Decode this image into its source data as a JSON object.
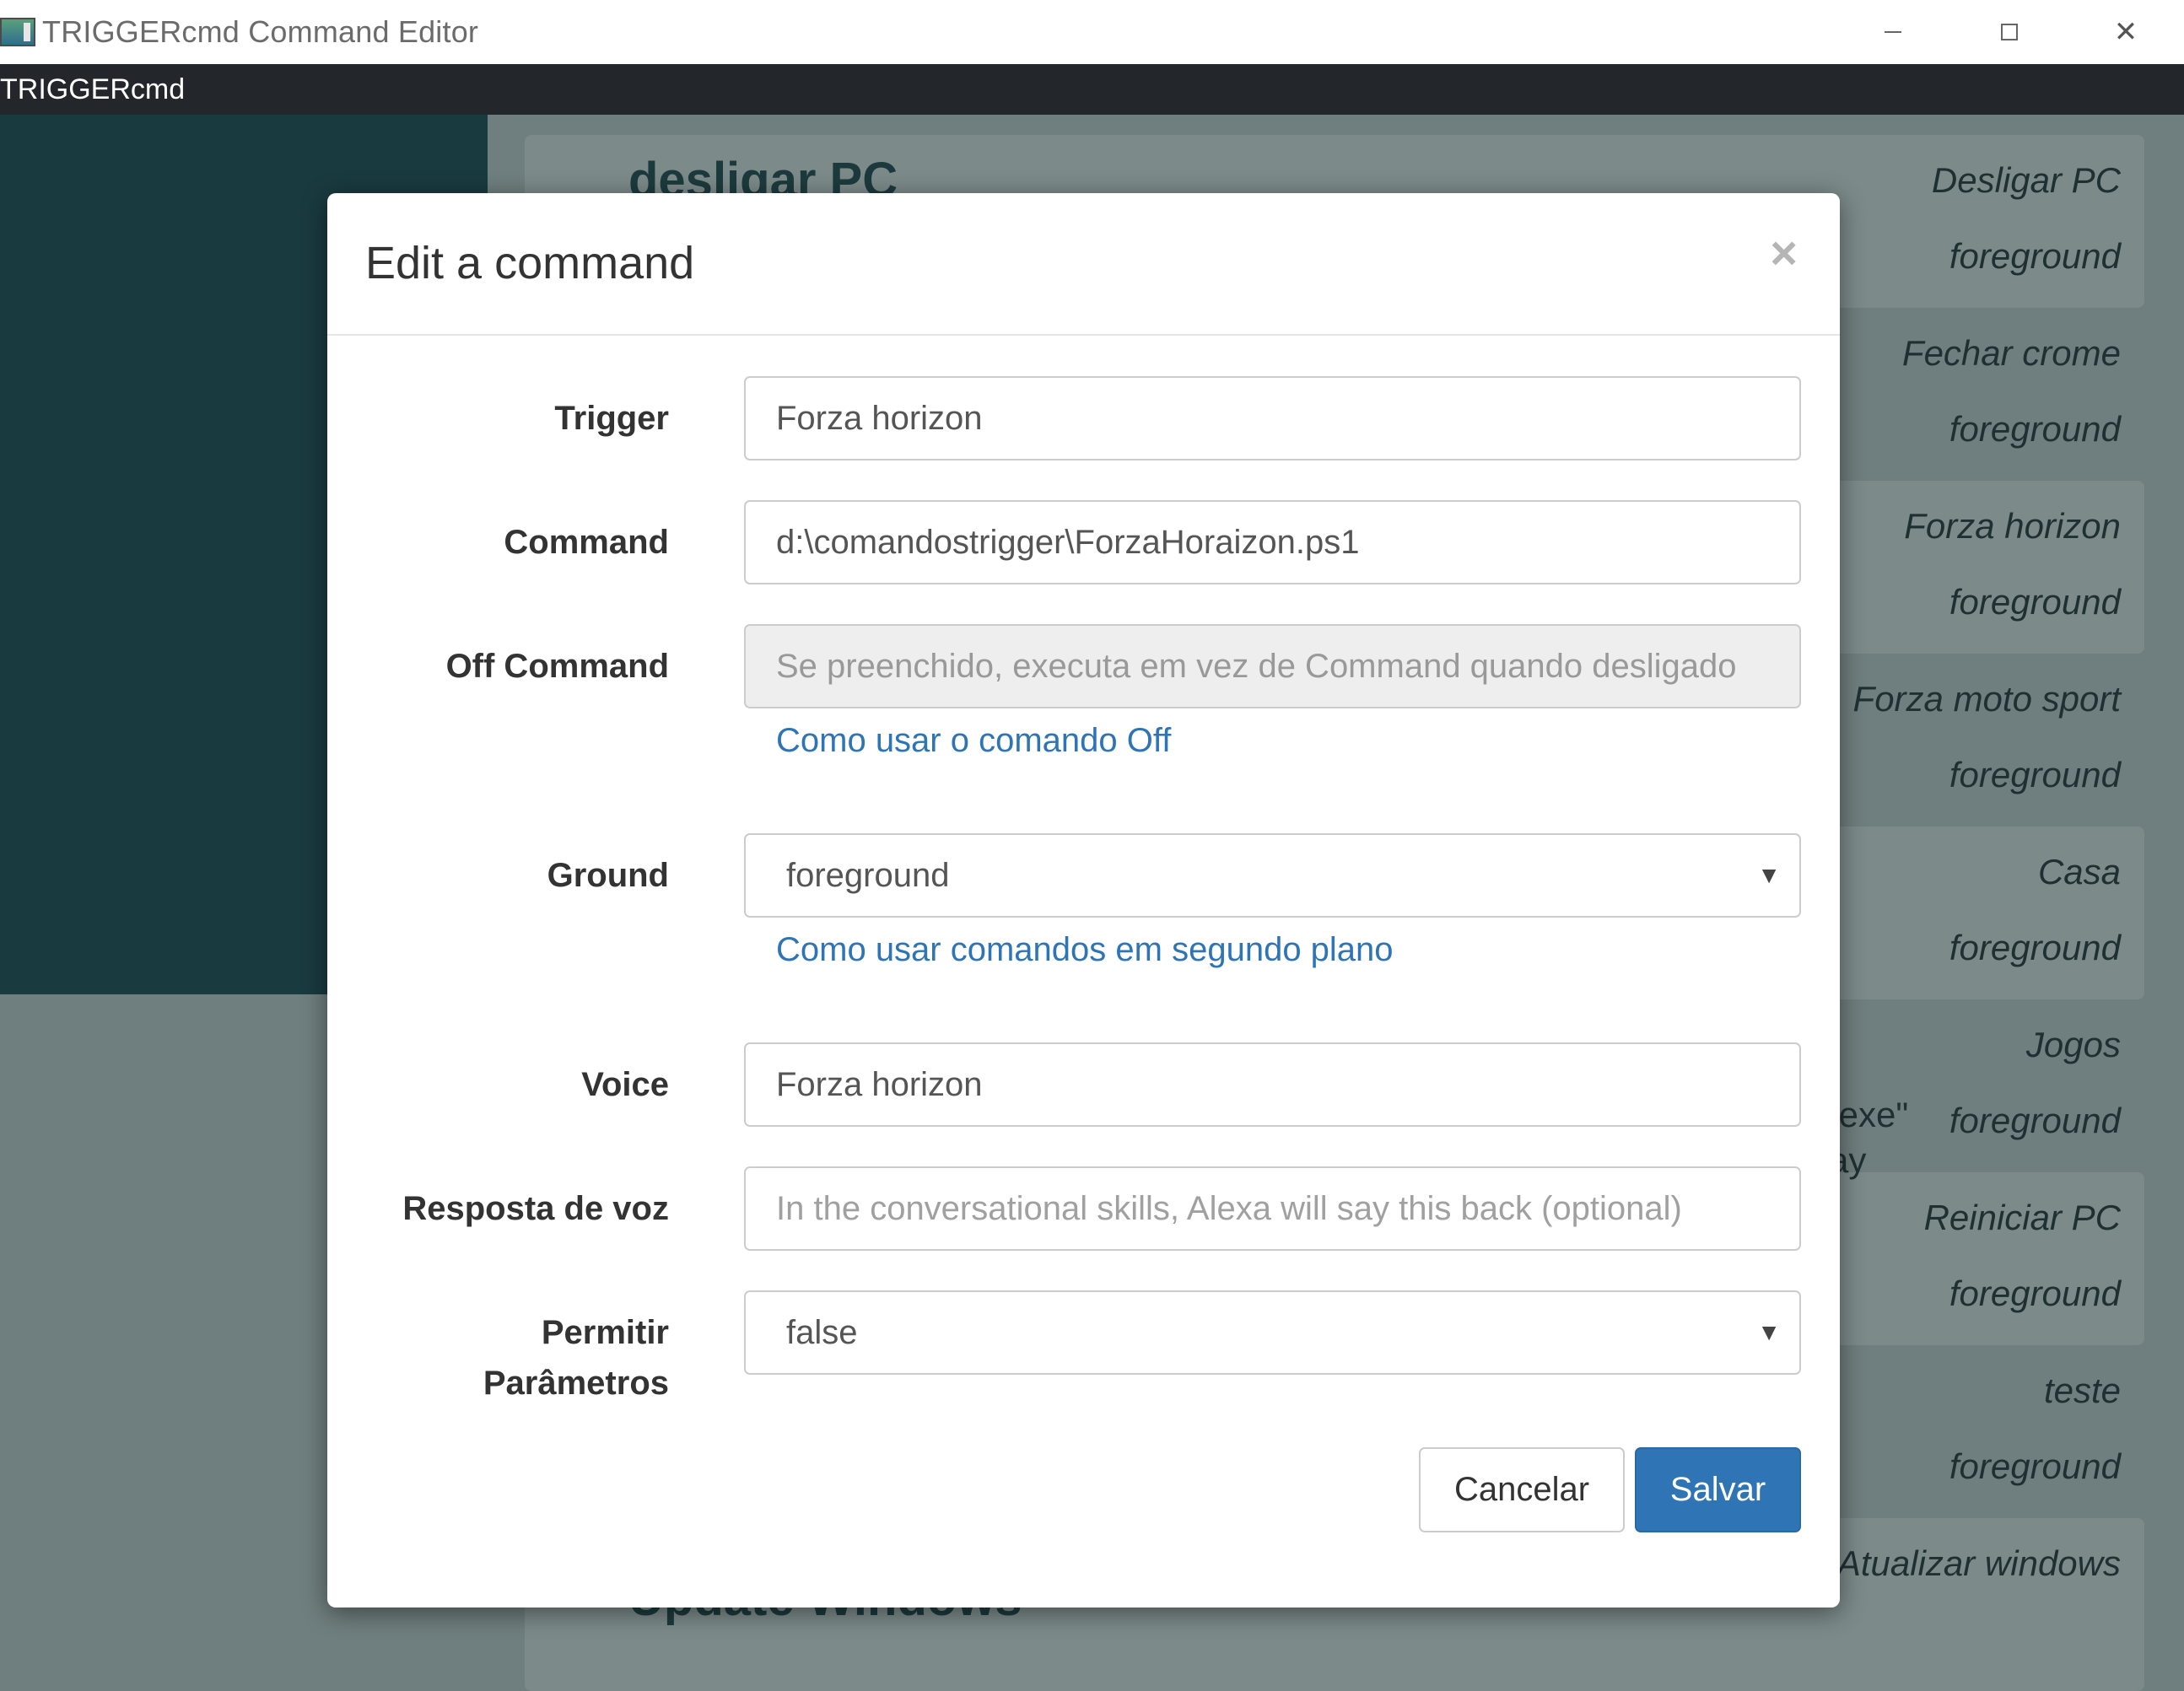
{
  "window": {
    "title": "TRIGGERcmd Command Editor",
    "minimize_label": "—",
    "maximize_label": "□",
    "close_label": "✕"
  },
  "menubar": {
    "brand": "TRIGGERcmd"
  },
  "background": {
    "heading_top": "desligar PC",
    "heading_bottom": "Update Windows",
    "snippet_1": ".exe\"",
    "snippet_2": "ay",
    "commands": [
      {
        "name": "Desligar PC",
        "ground": "foreground"
      },
      {
        "name": "Fechar crome",
        "ground": "foreground"
      },
      {
        "name": "Forza horizon",
        "ground": "foreground"
      },
      {
        "name": "Forza moto sport",
        "ground": "foreground"
      },
      {
        "name": "Casa",
        "ground": "foreground"
      },
      {
        "name": "Jogos",
        "ground": "foreground"
      },
      {
        "name": "Reiniciar PC",
        "ground": "foreground"
      },
      {
        "name": "teste",
        "ground": "foreground"
      },
      {
        "name": "Atualizar windows",
        "ground": ""
      }
    ]
  },
  "modal": {
    "title": "Edit a command",
    "close_icon": "×",
    "fields": {
      "trigger": {
        "label": "Trigger",
        "value": "Forza horizon"
      },
      "command": {
        "label": "Command",
        "value": "d:\\comandostrigger\\ForzaHoraizon.ps1"
      },
      "off_command": {
        "label": "Off Command",
        "placeholder": "Se preenchido, executa em vez de Command quando desligado"
      },
      "off_help": "Como usar o comando Off",
      "ground": {
        "label": "Ground",
        "value": "foreground"
      },
      "ground_help": "Como usar comandos em segundo plano",
      "voice": {
        "label": "Voice",
        "value": "Forza horizon"
      },
      "voice_reply": {
        "label": "Resposta de voz",
        "placeholder": "In the conversational skills, Alexa will say this back (optional)"
      },
      "allow_params": {
        "label_line1": "Permitir",
        "label_line2": "Parâmetros",
        "value": "false"
      }
    },
    "buttons": {
      "cancel": "Cancelar",
      "save": "Salvar"
    }
  },
  "colors": {
    "primary": "#2f74b5",
    "sidebar": "#193a3f",
    "menubar": "#23272b"
  }
}
